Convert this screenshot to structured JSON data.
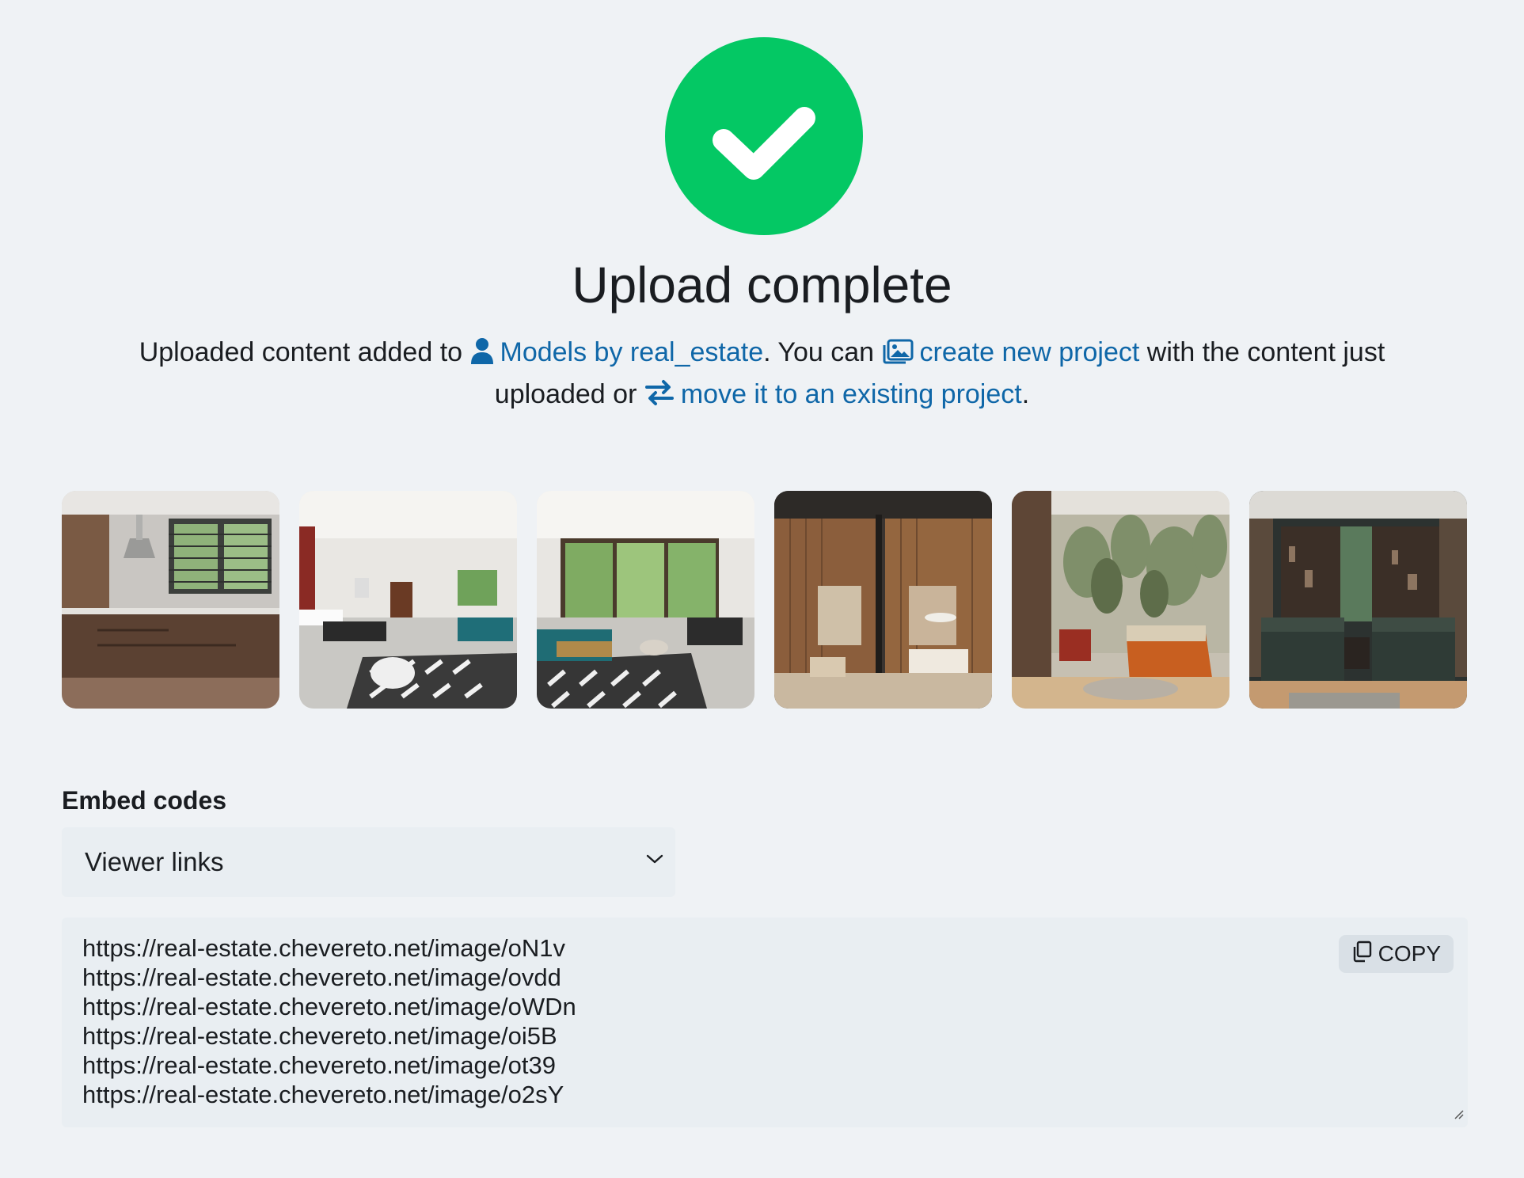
{
  "status": {
    "icon": "check-icon",
    "color": "#04c864",
    "title": "Upload complete"
  },
  "message": {
    "part1": "Uploaded content added to ",
    "owner_link": "Models by real_estate",
    "part2": ". You can ",
    "create_link": "create new project",
    "part3": " with the content just uploaded or ",
    "move_link": "move it to an existing project",
    "part4": ".",
    "icons": [
      "user-icon",
      "images-icon",
      "arrows-exchange-icon"
    ],
    "link_color": "#0f67a8"
  },
  "thumbnails": [
    {
      "subject": "kitchen"
    },
    {
      "subject": "living-room"
    },
    {
      "subject": "living-room-patio"
    },
    {
      "subject": "wood-panel-lounge"
    },
    {
      "subject": "tropical-bedroom"
    },
    {
      "subject": "dark-twin-bedroom"
    }
  ],
  "embed": {
    "label": "Embed codes",
    "selected_option": "Viewer links",
    "copy_label": "COPY",
    "codes": [
      "https://real-estate.chevereto.net/image/oN1v",
      "https://real-estate.chevereto.net/image/ovdd",
      "https://real-estate.chevereto.net/image/oWDn",
      "https://real-estate.chevereto.net/image/oi5B",
      "https://real-estate.chevereto.net/image/ot39",
      "https://real-estate.chevereto.net/image/o2sY"
    ]
  }
}
